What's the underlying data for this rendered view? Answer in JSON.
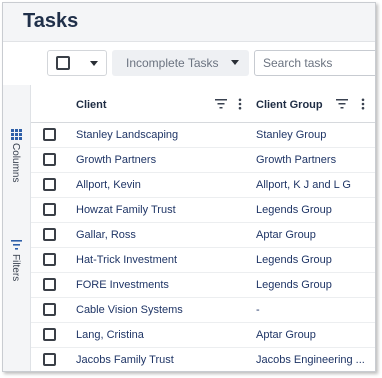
{
  "page": {
    "title": "Tasks"
  },
  "toolbar": {
    "task_filter": "Incomplete Tasks",
    "search_placeholder": "Search tasks"
  },
  "side_panel": {
    "columns_label": "Columns",
    "filters_label": "Filters"
  },
  "table": {
    "columns": [
      "Client",
      "Client Group"
    ],
    "rows": [
      {
        "client": "Stanley Landscaping",
        "group": "Stanley Group"
      },
      {
        "client": "Growth Partners",
        "group": "Growth Partners"
      },
      {
        "client": "Allport, Kevin",
        "group": "Allport, K J and L G"
      },
      {
        "client": "Howzat Family Trust",
        "group": "Legends Group"
      },
      {
        "client": "Gallar, Ross",
        "group": "Aptar Group"
      },
      {
        "client": "Hat-Trick Investment",
        "group": "Legends Group"
      },
      {
        "client": "FORE Investments",
        "group": "Legends Group"
      },
      {
        "client": "Cable Vision Systems",
        "group": "-"
      },
      {
        "client": "Lang, Cristina",
        "group": "Aptar Group"
      },
      {
        "client": "Jacobs Family Trust",
        "group": "Jacobs Engineering ..."
      }
    ]
  },
  "icons": {
    "select_checkbox": "checkbox-icon",
    "select_caret": "caret-down-icon",
    "filter_caret": "caret-down-icon",
    "columns": "grid-icon",
    "filters": "filter-icon",
    "column_filter": "filter-lines-icon",
    "column_menu": "kebab-menu-icon"
  }
}
